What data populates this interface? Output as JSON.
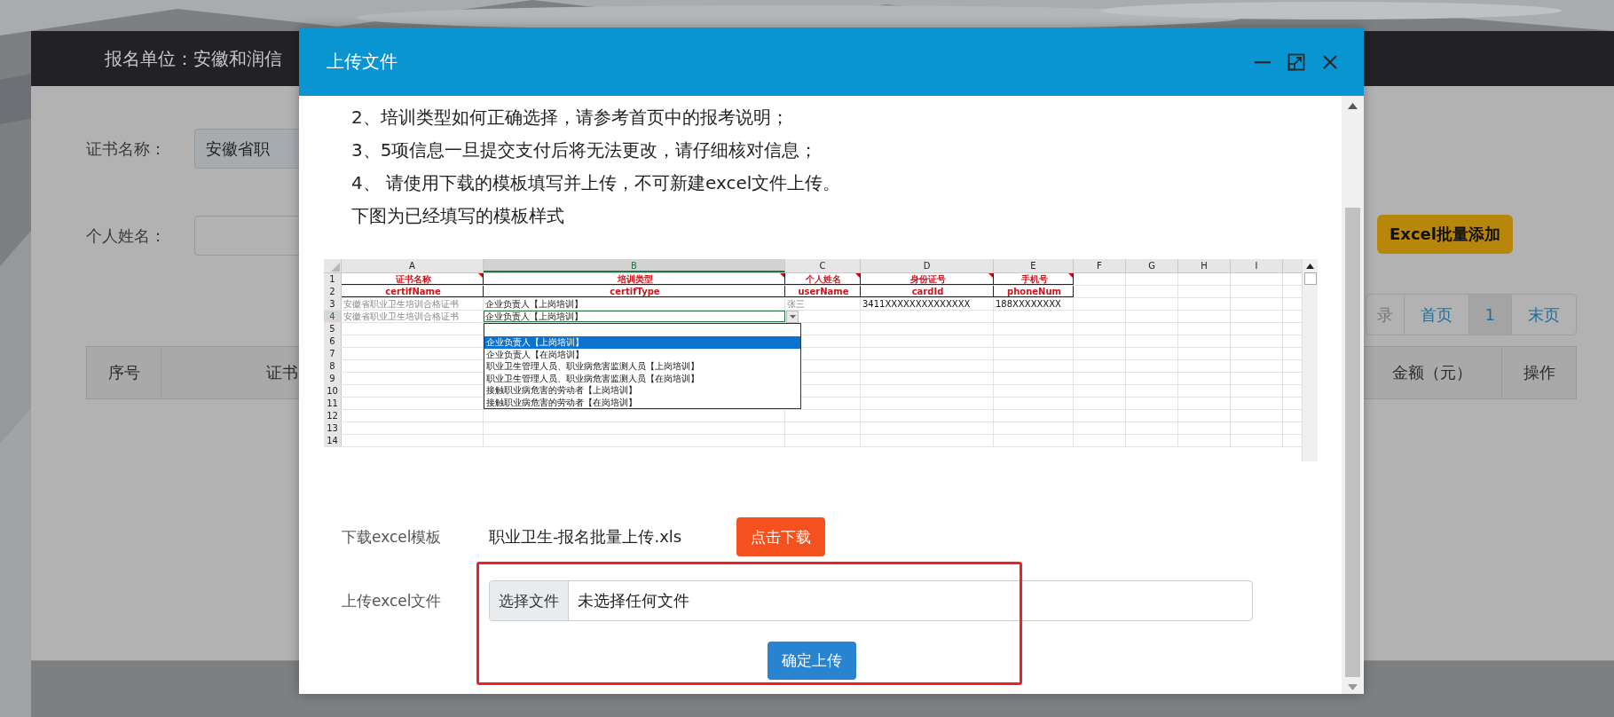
{
  "page": {
    "unit_label": "报名单位：安徽和润信",
    "filters": [
      {
        "kind": "select",
        "label": "证书名称：",
        "value": "安徽省职"
      },
      {
        "kind": "input",
        "label": "个人姓名："
      }
    ],
    "batch_add_button": "Excel批量添加",
    "pagination": [
      {
        "kind": "info",
        "label": "录",
        "selected": false
      },
      {
        "kind": "link",
        "label": "首页",
        "selected": false
      },
      {
        "kind": "link",
        "label": "1",
        "selected": true
      },
      {
        "kind": "link",
        "label": "末页",
        "selected": false
      }
    ],
    "table": {
      "columns": [
        "序号",
        "证书",
        "金额（元）",
        "操作"
      ]
    }
  },
  "dialog": {
    "title": "上传文件",
    "instructions": [
      "2、培训类型如何正确选择，请参考首页中的报考说明；",
      "3、5项信息一旦提交支付后将无法更改，请仔细核对信息；",
      "4、 请使用下载的模板填写并上传，不可新建excel文件上传。",
      "下图为已经填写的模板样式"
    ],
    "template_sheet": {
      "columns": [
        {
          "label": "A",
          "selected": false
        },
        {
          "label": "B",
          "selected": true
        },
        {
          "label": "C",
          "selected": false
        },
        {
          "label": "D",
          "selected": false
        },
        {
          "label": "E",
          "selected": false
        },
        {
          "label": "F",
          "selected": false
        },
        {
          "label": "G",
          "selected": false
        },
        {
          "label": "H",
          "selected": false
        },
        {
          "label": "I",
          "selected": false
        }
      ],
      "rows": [
        {
          "number": "1",
          "selected": false,
          "kind": "title",
          "cells": [
            "证书名称",
            "培训类型",
            "个人姓名",
            "身份证号",
            "手机号"
          ]
        },
        {
          "number": "2",
          "selected": false,
          "kind": "key",
          "cells": [
            "certifName",
            "certifType",
            "userName",
            "cardId",
            "phoneNum"
          ]
        },
        {
          "number": "3",
          "selected": false,
          "kind": "data",
          "cells": [
            "安徽省职业卫生培训合格证书",
            "企业负责人【上岗培训】",
            "张三",
            "3411XXXXXXXXXXXXXX",
            "188XXXXXXXX"
          ]
        },
        {
          "number": "4",
          "selected": true,
          "kind": "data",
          "cells": [
            "安徽省职业卫生培训合格证书",
            "企业负责人【上岗培训】"
          ]
        },
        {
          "number": "5",
          "selected": false,
          "kind": "data"
        },
        {
          "number": "6",
          "selected": false,
          "kind": "data"
        },
        {
          "number": "7",
          "selected": false,
          "kind": "data"
        },
        {
          "number": "8",
          "selected": false,
          "kind": "data"
        },
        {
          "number": "9",
          "selected": false,
          "kind": "data"
        },
        {
          "number": "10",
          "selected": false,
          "kind": "data"
        },
        {
          "number": "11",
          "selected": false,
          "kind": "data"
        },
        {
          "number": "12",
          "selected": false,
          "kind": "data"
        },
        {
          "number": "13",
          "selected": false,
          "kind": "data"
        },
        {
          "number": "14",
          "selected": false,
          "kind": "data"
        }
      ],
      "dropdown": [
        {
          "label": "企业负责人【上岗培训】",
          "selected": true
        },
        {
          "label": "企业负责人【在岗培训】",
          "selected": false
        },
        {
          "label": "职业卫生管理人员、职业病危害监测人员【上岗培训】",
          "selected": false
        },
        {
          "label": "职业卫生管理人员、职业病危害监测人员【在岗培训】",
          "selected": false
        },
        {
          "label": "接触职业病危害的劳动者【上岗培训】",
          "selected": false
        },
        {
          "label": "接触职业病危害的劳动者【在岗培训】",
          "selected": false
        }
      ]
    },
    "download": {
      "label": "下载excel模板",
      "file_name": "职业卫生-报名批量上传.xls",
      "button": "点击下载"
    },
    "upload": {
      "label": "上传excel文件",
      "choose_button": "选择文件",
      "file_status": "未选择任何文件",
      "submit_button": "确定上传",
      "highlighted": true
    }
  }
}
